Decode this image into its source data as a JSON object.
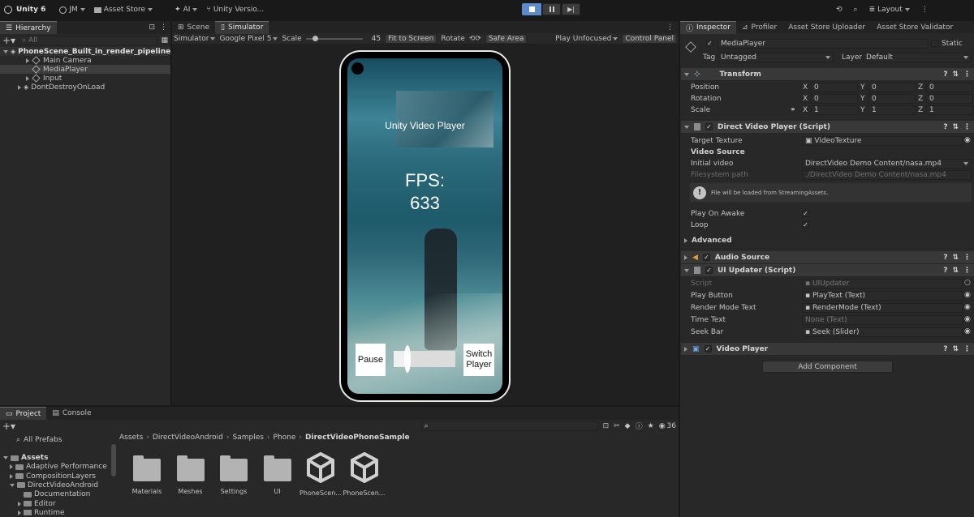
{
  "toolbar": {
    "unity": "Unity 6",
    "account": "JM",
    "asset_store": "Asset Store",
    "ai": "AI",
    "vc": "Unity Versio...",
    "layout": "Layout"
  },
  "hierarchy": {
    "tab": "Hierarchy",
    "search": "All",
    "scene": "PhoneScene_Built_in_render_pipeline",
    "items": [
      "Main Camera",
      "MediaPlayer",
      "Input"
    ],
    "ddol": "DontDestroyOnLoad"
  },
  "sim": {
    "tab_scene": "Scene",
    "tab_sim": "Simulator",
    "mode": "Simulator",
    "device": "Google Pixel 5",
    "scale_label": "Scale",
    "scale_value": "45",
    "fit": "Fit to Screen",
    "rotate": "Rotate",
    "safe": "Safe Area",
    "play_mode": "Play Unfocused",
    "control": "Control Panel"
  },
  "phone": {
    "title": "Unity Video Player",
    "fps_label": "FPS:",
    "fps_value": "633",
    "pause": "Pause",
    "switch": "Switch Player",
    "seek_progress": 0.22
  },
  "inspector": {
    "tabs": [
      "Inspector",
      "Profiler",
      "Asset Store Uploader",
      "Asset Store Validator"
    ],
    "object_name": "MediaPlayer",
    "static": "Static",
    "tag_label": "Tag",
    "tag": "Untagged",
    "layer_label": "Layer",
    "layer": "Default",
    "transform": {
      "title": "Transform",
      "rows": [
        {
          "label": "Position",
          "x": "0",
          "y": "0",
          "z": "0"
        },
        {
          "label": "Rotation",
          "x": "0",
          "y": "0",
          "z": "0"
        },
        {
          "label": "Scale",
          "x": "1",
          "y": "1",
          "z": "1"
        }
      ]
    },
    "dvp": {
      "title": "Direct Video Player (Script)",
      "target_label": "Target Texture",
      "target": "VideoTexture",
      "source_header": "Video Source",
      "initial_label": "Initial video",
      "initial": "DirectVideo Demo Content/nasa.mp4",
      "fs_label": "Filesystem path",
      "fs": "./DirectVideo Demo Content/nasa.mp4",
      "info": "File will be loaded from StreamingAssets.",
      "poa": "Play On Awake",
      "loop": "Loop",
      "advanced": "Advanced"
    },
    "audio": {
      "title": "Audio Source"
    },
    "ui": {
      "title": "UI Updater (Script)",
      "rows": [
        {
          "label": "Script",
          "value": "UIUpdater"
        },
        {
          "label": "Play Button",
          "value": "PlayText (Text)"
        },
        {
          "label": "Render Mode Text",
          "value": "RenderMode (Text)"
        },
        {
          "label": "Time Text",
          "value": "None (Text)"
        },
        {
          "label": "Seek Bar",
          "value": "Seek (Slider)"
        }
      ]
    },
    "vp": {
      "title": "Video Player"
    },
    "add": "Add Component"
  },
  "project": {
    "tab_project": "Project",
    "tab_console": "Console",
    "count": "36",
    "favorites": "All Prefabs",
    "tree": [
      "Assets",
      "Adaptive Performance",
      "CompositionLayers",
      "DirectVideoAndroid",
      "Documentation",
      "Editor",
      "Runtime"
    ],
    "breadcrumb": [
      "Assets",
      "DirectVideoAndroid",
      "Samples",
      "Phone",
      "DirectVideoPhoneSample"
    ],
    "items": [
      "Materials",
      "Meshes",
      "Settings",
      "UI",
      "PhoneScen...",
      "PhoneScen..."
    ]
  }
}
